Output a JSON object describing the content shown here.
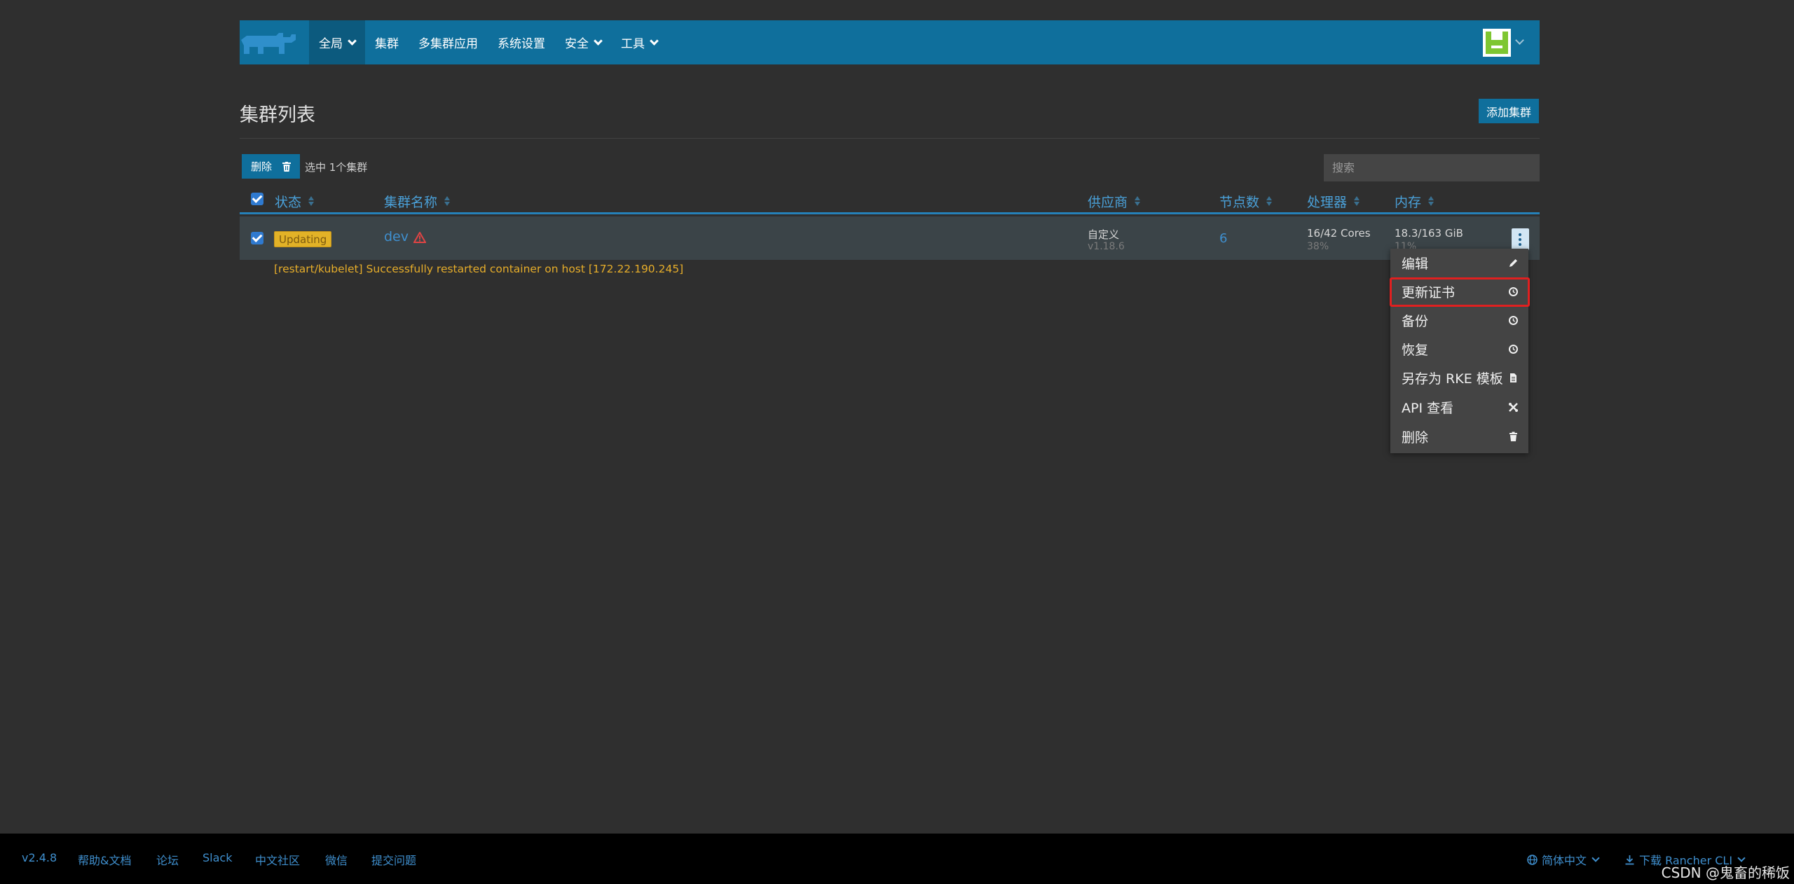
{
  "header": {
    "nav": [
      {
        "label": "全局",
        "dropdown": true,
        "active": true
      },
      {
        "label": "集群",
        "dropdown": false
      },
      {
        "label": "多集群应用",
        "dropdown": false
      },
      {
        "label": "系统设置",
        "dropdown": false
      },
      {
        "label": "安全",
        "dropdown": true
      },
      {
        "label": "工具",
        "dropdown": true
      }
    ],
    "brand_color": "#0f6f9c"
  },
  "page": {
    "title": "集群列表",
    "add_button": "添加集群",
    "delete_button": "删除",
    "selected_text": "选中 1个集群",
    "search_placeholder": "搜索"
  },
  "table": {
    "columns": [
      "状态",
      "集群名称",
      "供应商",
      "节点数",
      "处理器",
      "内存"
    ],
    "rows": [
      {
        "checked": true,
        "state": "Updating",
        "name": "dev",
        "provider": "自定义",
        "provider_version": "v1.18.6",
        "nodes": "6",
        "cpu": "16/42 Cores",
        "cpu_pct": "38%",
        "memory": "18.3/163 GiB",
        "memory_pct": "11%",
        "message": "[restart/kubelet] Successfully restarted container on host [172.22.190.245]"
      }
    ]
  },
  "action_menu": {
    "items": [
      {
        "label": "编辑",
        "icon": "pencil-icon"
      },
      {
        "label": "更新证书",
        "icon": "history-icon",
        "highlighted": true
      },
      {
        "label": "备份",
        "icon": "history-icon"
      },
      {
        "label": "恢复",
        "icon": "history-icon"
      },
      {
        "label": "另存为 RKE 模板",
        "icon": "file-icon"
      },
      {
        "label": "API 查看",
        "icon": "api-icon"
      },
      {
        "label": "删除",
        "icon": "trash-icon"
      }
    ]
  },
  "footer": {
    "version": "v2.4.8",
    "links": [
      "帮助&文档",
      "论坛",
      "Slack",
      "中文社区",
      "微信",
      "提交问题"
    ],
    "language": "简体中文",
    "download": "下载 Rancher CLI"
  },
  "watermark": "CSDN @鬼畜的稀饭"
}
